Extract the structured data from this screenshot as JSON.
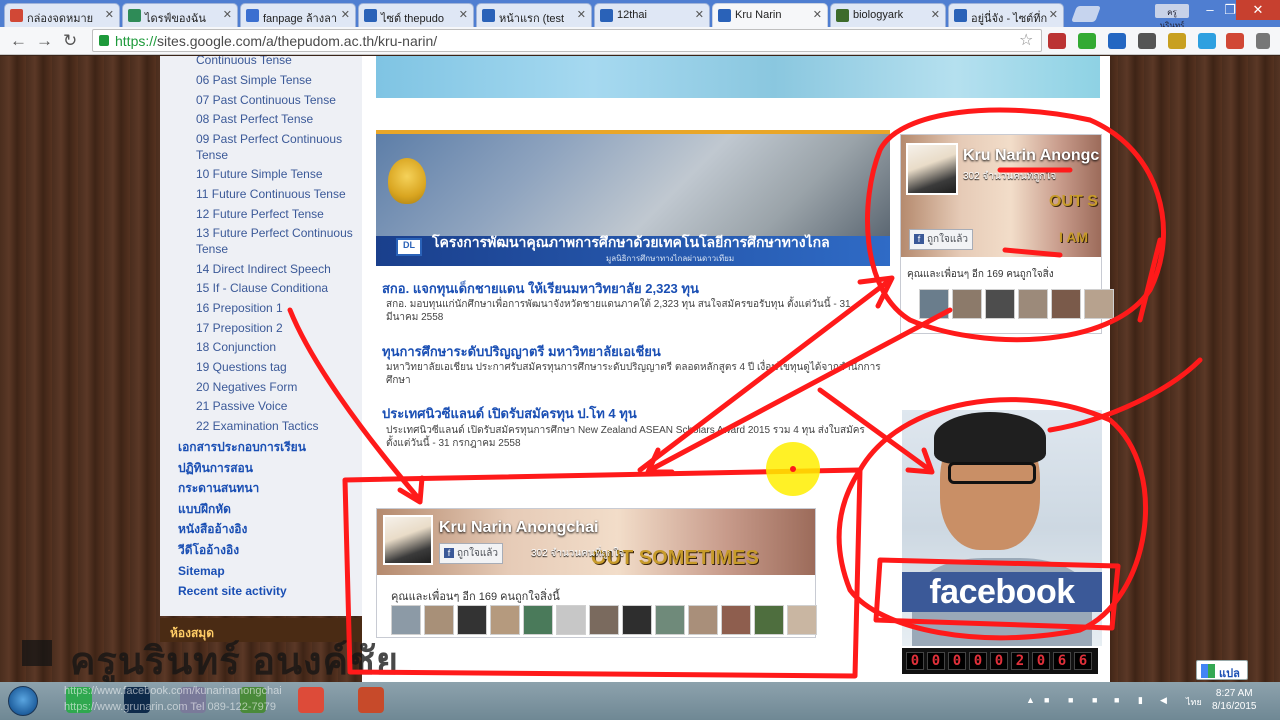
{
  "browser": {
    "tabs": [
      {
        "label": "กล่องจดหมาย",
        "icon": "gmail-icon",
        "color": "#d14836"
      },
      {
        "label": "ไดรฟ์ของฉัน",
        "icon": "drive-icon",
        "color": "#2e8b57"
      },
      {
        "label": "fanpage ล้างลา",
        "icon": "doc-icon",
        "color": "#3b6fd0"
      },
      {
        "label": "ไซต์ thepudo",
        "icon": "sites-icon",
        "color": "#2a62b8"
      },
      {
        "label": "หน้าแรก (test",
        "icon": "sites-icon",
        "color": "#2a62b8"
      },
      {
        "label": "12thai",
        "icon": "sites-icon",
        "color": "#2a62b8"
      },
      {
        "label": "Kru Narin",
        "icon": "sites-icon",
        "color": "#2a62b8"
      },
      {
        "label": "biologyark",
        "icon": "page-icon",
        "color": "#3d6b2a"
      },
      {
        "label": "อยู่นี่จัง - ไซต์ที่ก",
        "icon": "sites-icon",
        "color": "#2a62b8"
      }
    ],
    "url_proto": "https://",
    "url_rest": "sites.google.com/a/thepudom.ac.th/kru-narin/"
  },
  "sidebar": {
    "items": [
      "Continuous Tense",
      "06 Past Simple Tense",
      "07 Past Continuous Tense",
      "08 Past Perfect Tense",
      "09 Past Perfect Continuous Tense",
      "10 Future Simple Tense",
      "11 Future Continuous Tense",
      "12 Future Perfect Tense",
      "13 Future Perfect Continuous Tense",
      "14 Direct Indirect Speech",
      "15 If - Clause Conditiona",
      "16 Preposition 1",
      "17 Preposition 2",
      "18 Conjunction",
      "19 Questions tag",
      "20 Negatives Form",
      "21 Passive Voice",
      "22 Examination Tactics"
    ],
    "categories": [
      "เอกสารประกอบการเรียน",
      "ปฏิทินการสอน",
      "กระดานสนทนา",
      "แบบฝึกหัด",
      "หนังสืออ้างอิง",
      "วีดีโออ้างอิง"
    ],
    "links": [
      "Sitemap",
      "Recent site activity"
    ],
    "library_label": "ห้องสมุด"
  },
  "news": {
    "banner_caption": "โครงการพัฒนาคุณภาพการศึกษาด้วยเทคโนโลยีการศึกษาทางไกล",
    "banner_sub": "มูลนิธิการศึกษาทางไกลผ่านดาวเทียม",
    "logo_label": "DL",
    "items": [
      {
        "title": "สกอ. แจกทุนเด็กชายแดน ให้เรียนมหาวิทยาลัย 2,323 ทุน",
        "body": "สกอ. มอบทุนแก่นักศึกษาเพื่อการพัฒนาจังหวัดชายแดนภาคใต้ 2,323 ทุน สนใจสมัครขอรับทุน ตั้งแต่วันนี้ - 31 มีนาคม 2558"
      },
      {
        "title": "ทุนการศึกษาระดับปริญญาตรี มหาวิทยาลัยเอเชียน",
        "body": "มหาวิทยาลัยเอเชียน ประกาศรับสมัครทุนการศึกษาระดับปริญญาตรี ตลอดหลักสูตร 4 ปี เงื่อนไขทุนดูได้จากสำนักการศึกษา"
      },
      {
        "title": "ประเทศนิวซีแลนด์ เปิดรับสมัครทุน ป.โท 4 ทุน",
        "body": "ประเทศนิวซีแลนด์ เปิดรับสมัครทุนการศึกษา New Zealand ASEAN Scholars Award 2015 รวม 4 ทุน ส่งใบสมัครตั้งแต่วันนี้ - 31 กรกฎาคม 2558"
      }
    ]
  },
  "fb_small": {
    "name": "Kru Narin Anongc",
    "count": "302 จำนวนคนที่ถูกใจ",
    "like": "ถูกใจแล้ว",
    "friends": "คุณและเพื่อนๆ อีก 169 คนถูกใจสิ่ง",
    "cover_text": "OUT S",
    "cover_text2": "I AM"
  },
  "fb_large": {
    "name": "Kru Narin Anongchai",
    "like": "ถูกใจแล้ว",
    "count": "302 จำนวนคนที่ถูกใจ",
    "friends": "คุณและเพื่อนๆ อีก 169 คนถูกใจสิ่งนี้",
    "cover_text": "OUT SOMETIMES"
  },
  "profile": {
    "fb_logo": "facebook"
  },
  "counter_digits": [
    "0",
    "0",
    "0",
    "0",
    "0",
    "2",
    "0",
    "6",
    "6"
  ],
  "translate_label": "แปล",
  "watermark": "ครูนรินทร์ อนงค์ชัย",
  "taskbar_text": [
    "https://www.facebook.com/kunarinanongchai",
    "https://www.grunarin.com  Tel 089-122-7979"
  ],
  "clock": {
    "time": "8:27 AM",
    "date": "8/16/2015"
  },
  "user_badge": "ครูนรินทร์",
  "colors": {
    "fb_blue": "#3b5998",
    "annotation_red": "#ff1a1a",
    "cursor_yellow": "#ffee00",
    "counter_red": "#e0303a"
  }
}
